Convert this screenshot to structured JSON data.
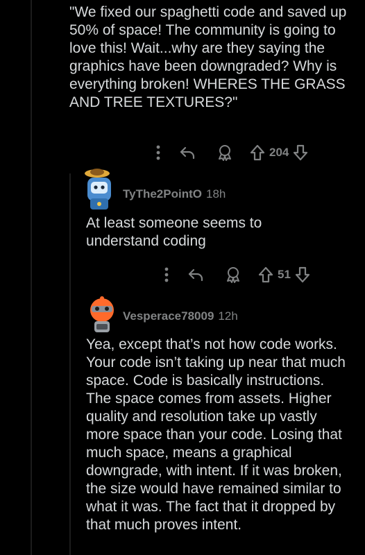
{
  "comments": [
    {
      "text": "\"We fixed our spaghetti code and saved up 50% of space! The community is going to love this! Wait...why are they saying the graphics have been downgraded? Why is everything broken! WHERES THE GRASS AND TREE TEXTURES?\"",
      "votes": "204"
    },
    {
      "username": "TyThe2PointO",
      "time": "18h",
      "text": "At least someone seems to understand coding",
      "votes": "51"
    },
    {
      "username": "Vesperace78009",
      "time": "12h",
      "text": "Yea, except that’s not how code works. Your code isn’t taking up near that much space. Code is basically instructions. The space comes from assets. Higher quality and resolution take up vastly more space than your code. Losing that much space, means a graphical downgrade, with intent. If it was broken, the size would have remained similar to what it was. The fact that it dropped by that much proves intent."
    }
  ],
  "icons": {
    "more": "more-options-icon",
    "reply": "reply-icon",
    "award": "award-icon",
    "upvote": "upvote-arrow-icon",
    "downvote": "downvote-arrow-icon"
  },
  "colors": {
    "background": "#000000",
    "text": "#d7dadc",
    "muted": "#818384",
    "thread_line": "#1c1c1c"
  }
}
